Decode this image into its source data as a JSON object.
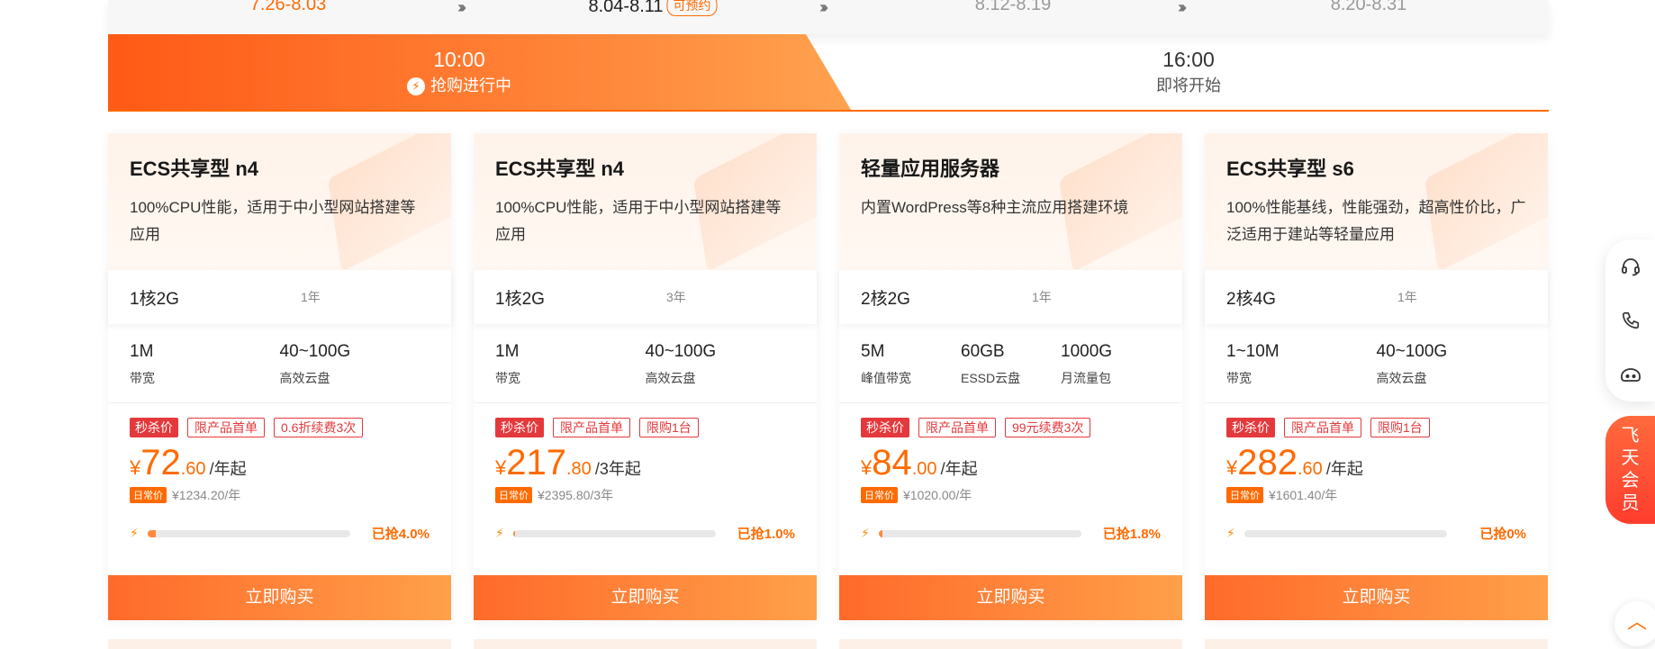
{
  "dates": [
    {
      "label": "7.26-8.03",
      "state": "past"
    },
    {
      "label": "8.04-8.11",
      "state": "current",
      "tag": "可预约"
    },
    {
      "label": "8.12-8.19",
      "state": "future"
    },
    {
      "label": "8.20-8.31",
      "state": "future"
    }
  ],
  "separator": "›››",
  "time_tabs": [
    {
      "time": "10:00",
      "status": "抢购进行中",
      "active": true
    },
    {
      "time": "16:00",
      "status": "即将开始",
      "active": false
    }
  ],
  "cards": [
    {
      "title": "ECS共享型 n4",
      "desc": "100%CPU性能，适用于中小型网站搭建等应用",
      "spec": "1核2G",
      "term": "1年",
      "params": [
        {
          "value": "1M",
          "label": "带宽"
        },
        {
          "value": "40~100G",
          "label": "高效云盘"
        }
      ],
      "tags": [
        "秒杀价",
        "限产品首单",
        "0.6折续费3次"
      ],
      "price_currency": "¥",
      "price_int": "72",
      "price_dec": ".60",
      "price_unit": "/年起",
      "orig_badge": "日常价",
      "orig_price": "¥1234.20/年",
      "progress": 0.04,
      "grabbed": "已抢4.0%",
      "buy": "立即购买"
    },
    {
      "title": "ECS共享型 n4",
      "desc": "100%CPU性能，适用于中小型网站搭建等应用",
      "spec": "1核2G",
      "term": "3年",
      "params": [
        {
          "value": "1M",
          "label": "带宽"
        },
        {
          "value": "40~100G",
          "label": "高效云盘"
        }
      ],
      "tags": [
        "秒杀价",
        "限产品首单",
        "限购1台"
      ],
      "price_currency": "¥",
      "price_int": "217",
      "price_dec": ".80",
      "price_unit": "/3年起",
      "orig_badge": "日常价",
      "orig_price": "¥2395.80/3年",
      "progress": 0.01,
      "grabbed": "已抢1.0%",
      "buy": "立即购买"
    },
    {
      "title": "轻量应用服务器",
      "desc": "内置WordPress等8种主流应用搭建环境",
      "spec": "2核2G",
      "term": "1年",
      "params": [
        {
          "value": "5M",
          "label": "峰值带宽"
        },
        {
          "value": "60GB",
          "label": "ESSD云盘"
        },
        {
          "value": "1000G",
          "label": "月流量包"
        }
      ],
      "tags": [
        "秒杀价",
        "限产品首单",
        "99元续费3次"
      ],
      "price_currency": "¥",
      "price_int": "84",
      "price_dec": ".00",
      "price_unit": "/年起",
      "orig_badge": "日常价",
      "orig_price": "¥1020.00/年",
      "progress": 0.018,
      "grabbed": "已抢1.8%",
      "buy": "立即购买"
    },
    {
      "title": "ECS共享型 s6",
      "desc": "100%性能基线，性能强劲，超高性价比，广泛适用于建站等轻量应用",
      "spec": "2核4G",
      "term": "1年",
      "params": [
        {
          "value": "1~10M",
          "label": "带宽"
        },
        {
          "value": "40~100G",
          "label": "高效云盘"
        }
      ],
      "tags": [
        "秒杀价",
        "限产品首单",
        "限购1台"
      ],
      "price_currency": "¥",
      "price_int": "282",
      "price_dec": ".60",
      "price_unit": "/年起",
      "orig_badge": "日常价",
      "orig_price": "¥1601.40/年",
      "progress": 0.0,
      "grabbed": "已抢0%",
      "buy": "立即购买"
    }
  ],
  "float_bar": {
    "icons": [
      "headset-icon",
      "phone-icon",
      "robot-icon"
    ],
    "member": "飞天会员",
    "top_icon": "chevron-up-icon"
  },
  "colors": {
    "accent": "#ff6a00",
    "tag_red": "#e4393c"
  }
}
